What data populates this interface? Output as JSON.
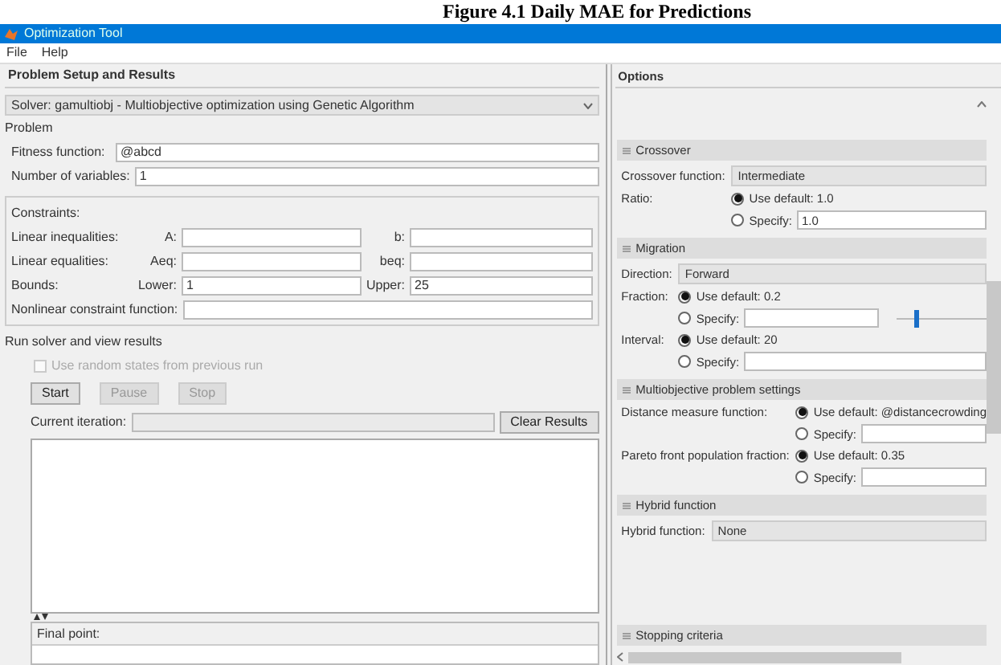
{
  "caption": "Figure 4.1 Daily MAE for Predictions",
  "window": {
    "title": "Optimization Tool"
  },
  "menu": [
    {
      "label": "File"
    },
    {
      "label": "Help"
    }
  ],
  "setup": {
    "header": "Problem Setup and Results",
    "solver": {
      "label": "Solver:",
      "value": "gamultiobj - Multiobjective optimization using Genetic Algorithm"
    },
    "problem": {
      "legend": "Problem",
      "fields": [
        {
          "label": "Fitness function:",
          "value": "@abcd"
        },
        {
          "label": "Number of variables:",
          "value": "1"
        }
      ]
    },
    "constraints": {
      "legend": "Constraints:",
      "rows": [
        {
          "label": "Linear inequalities:",
          "a_label": "A:",
          "b_label": "b:"
        },
        {
          "label": "Linear equalities:",
          "a_label": "Aeq:",
          "b_label": "beq:"
        },
        {
          "label": "Bounds:",
          "a_label": "Lower:",
          "a_value": "1",
          "b_label": "Upper:",
          "b_value": "25"
        }
      ],
      "nonlinear": {
        "label": "Nonlinear constraint function:"
      }
    },
    "run": {
      "legend": "Run solver and view results",
      "checkbox": {
        "label": "Use random states from previous run",
        "checked": false,
        "disabled": true
      },
      "buttons": [
        {
          "label": "Start",
          "disabled": false
        },
        {
          "label": "Pause",
          "disabled": true
        },
        {
          "label": "Stop",
          "disabled": true
        }
      ],
      "iteration_label": "Current iteration:",
      "clear_button": "Clear Results"
    },
    "final_point": {
      "label": "Final point:"
    }
  },
  "options": {
    "header": "Options",
    "sections": [
      {
        "title": "Crossover",
        "rows": [
          {
            "kind": "select",
            "label": "Crossover function:",
            "value": "Intermediate"
          },
          {
            "kind": "radio",
            "label": "Ratio:",
            "option": "Use default: 1.0",
            "selected": true
          },
          {
            "kind": "radio_input",
            "option": "Specify:",
            "selected": false,
            "value": "1.0"
          }
        ]
      },
      {
        "title": "Migration",
        "rows": [
          {
            "kind": "select",
            "label": "Direction:",
            "value": "Forward"
          },
          {
            "kind": "radio",
            "label": "Fraction:",
            "option": "Use default: 0.2",
            "selected": true
          },
          {
            "kind": "radio_input",
            "option": "Specify:",
            "selected": false,
            "slider": {
              "level": 0.2
            }
          },
          {
            "kind": "radio",
            "label": "Interval:",
            "option": "Use default: 20",
            "selected": true
          },
          {
            "kind": "radio_input",
            "option": "Specify:",
            "selected": false
          }
        ]
      },
      {
        "title": "Multiobjective problem settings",
        "rows": [
          {
            "kind": "radio",
            "label": "Distance measure function:",
            "option": "Use default: @distancecrowding",
            "selected": true
          },
          {
            "kind": "radio_input",
            "option": "Specify:",
            "selected": false
          },
          {
            "kind": "radio",
            "label": "Pareto front population fraction:",
            "option": "Use default: 0.35",
            "selected": true
          },
          {
            "kind": "radio_input",
            "option": "Specify:",
            "selected": false
          }
        ]
      },
      {
        "title": "Hybrid function",
        "rows": [
          {
            "kind": "select",
            "label": "Hybrid function:",
            "value": "None"
          }
        ]
      },
      {
        "title": "Stopping criteria"
      }
    ]
  }
}
